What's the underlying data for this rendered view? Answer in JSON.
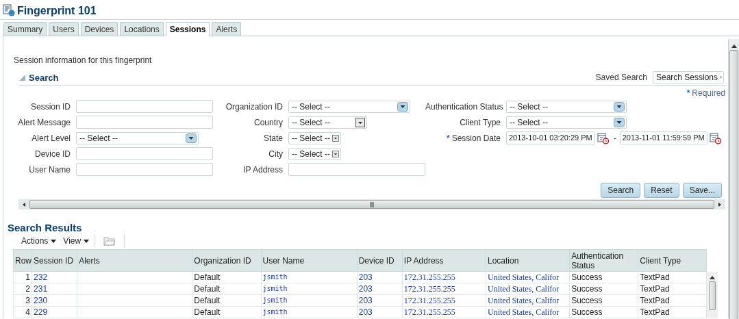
{
  "title": "Fingerprint 101",
  "tabs": [
    {
      "label": "Summary",
      "selected": false
    },
    {
      "label": "Users",
      "selected": false
    },
    {
      "label": "Devices",
      "selected": false
    },
    {
      "label": "Locations",
      "selected": false
    },
    {
      "label": "Sessions",
      "selected": true
    },
    {
      "label": "Alerts",
      "selected": false
    }
  ],
  "intro": "Session information for this fingerprint",
  "search": {
    "title": "Search",
    "expanded": true,
    "saved_search_label": "Saved Search",
    "saved_search_value": "Search Sessions",
    "required_note": {
      "mark": "*",
      "text": "Required"
    },
    "columns": [
      [
        {
          "label": "Session ID",
          "kind": "text"
        },
        {
          "label": "Alert Message",
          "kind": "text"
        },
        {
          "label": "Alert Level",
          "kind": "select",
          "value": "-- Select --"
        },
        {
          "label": "Device ID",
          "kind": "text"
        },
        {
          "label": "User Name",
          "kind": "text"
        }
      ],
      [
        {
          "label": "Organization ID",
          "kind": "select",
          "value": "-- Select --"
        },
        {
          "label": "Country",
          "kind": "compact_select",
          "value": "-- Select --"
        },
        {
          "label": "State",
          "kind": "compact_select",
          "value": "-- Select --"
        },
        {
          "label": "City",
          "kind": "compact_select",
          "value": "-- Select --"
        },
        {
          "label": "IP Address",
          "kind": "text"
        }
      ],
      [
        {
          "label": "Authentication Status",
          "kind": "select",
          "value": "-- Select --"
        },
        {
          "label": "Client Type",
          "kind": "select",
          "value": "-- Select --"
        },
        {
          "label": "Session Date",
          "kind": "date_range",
          "required_mark": "*",
          "from": "2013-10-01 03:20:29 PM",
          "separator": "-",
          "to": "2013-11-01 11:59:59 PM"
        }
      ]
    ],
    "buttons": [
      "Search",
      "Reset",
      "Save..."
    ]
  },
  "results": {
    "title": "Search Results",
    "menus": [
      "Actions",
      "View"
    ],
    "columns": [
      {
        "label": "Row",
        "kind": "row_number"
      },
      {
        "label": "Session ID",
        "kind": "link"
      },
      {
        "label": "Alerts",
        "kind": "plain"
      },
      {
        "label": "Organization ID",
        "kind": "plain"
      },
      {
        "label": "User Name",
        "kind": "mono_link"
      },
      {
        "label": "Device ID",
        "kind": "link"
      },
      {
        "label": "IP Address",
        "kind": "serif_link"
      },
      {
        "label": "Location",
        "kind": "serif_link"
      },
      {
        "label": "Authentication Status",
        "kind": "plain"
      },
      {
        "label": "Client Type",
        "kind": "plain"
      }
    ],
    "rows": [
      [
        "1",
        "232",
        "",
        "Default",
        "jsmith",
        "203",
        "172.31.255.255",
        "United States, Califor",
        "Success",
        "TextPad"
      ],
      [
        "2",
        "231",
        "",
        "Default",
        "jsmith",
        "203",
        "172.31.255.255",
        "United States, Califor",
        "Success",
        "TextPad"
      ],
      [
        "3",
        "230",
        "",
        "Default",
        "jsmith",
        "203",
        "172.31.255.255",
        "United States, Califor",
        "Success",
        "TextPad"
      ],
      [
        "4",
        "229",
        "",
        "Default",
        "jsmith",
        "203",
        "172.31.255.255",
        "United States, Califor",
        "Success",
        "TextPad"
      ]
    ]
  }
}
